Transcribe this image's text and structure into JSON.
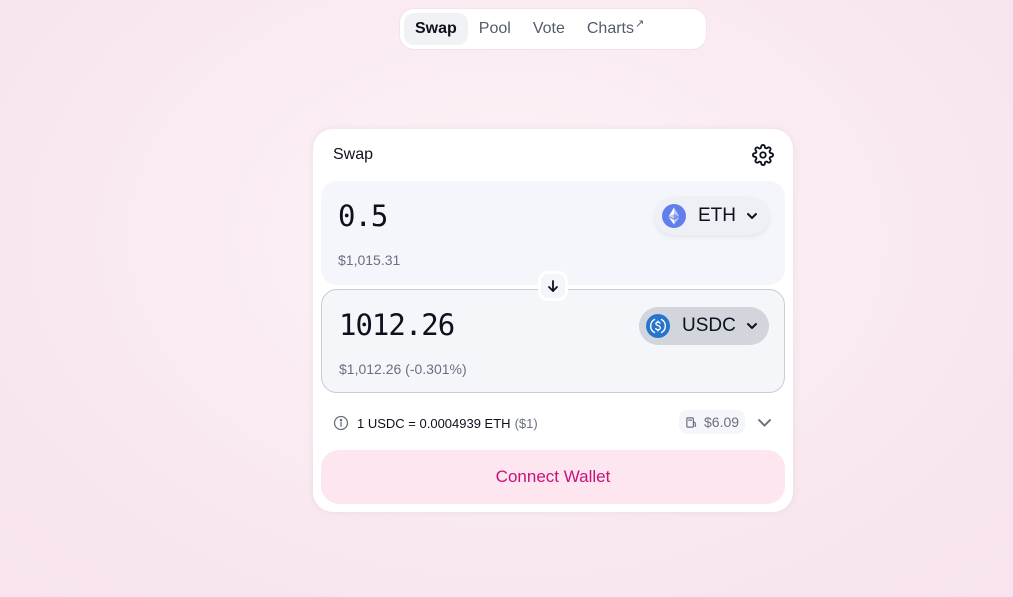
{
  "nav": {
    "tabs": [
      {
        "label": "Swap",
        "active": true
      },
      {
        "label": "Pool",
        "active": false
      },
      {
        "label": "Vote",
        "active": false
      },
      {
        "label": "Charts",
        "active": false
      }
    ],
    "external_arrow": "↗"
  },
  "swap": {
    "title": "Swap",
    "settings_icon": "gear-icon",
    "input": {
      "amount": "0.5",
      "fiat": "$1,015.31",
      "token": "ETH",
      "token_color": "#627eea"
    },
    "output": {
      "amount": "1012.26",
      "fiat": "$1,012.26 (-0.301%)",
      "token": "USDC",
      "token_color": "#2775ca"
    },
    "rate": {
      "text": "1 USDC = 0.0004939 ETH",
      "usd": "($1)"
    },
    "gas": "$6.09",
    "connect_label": "Connect Wallet"
  },
  "colors": {
    "accent": "#c8127a",
    "connect_bg": "#fde6ef"
  }
}
